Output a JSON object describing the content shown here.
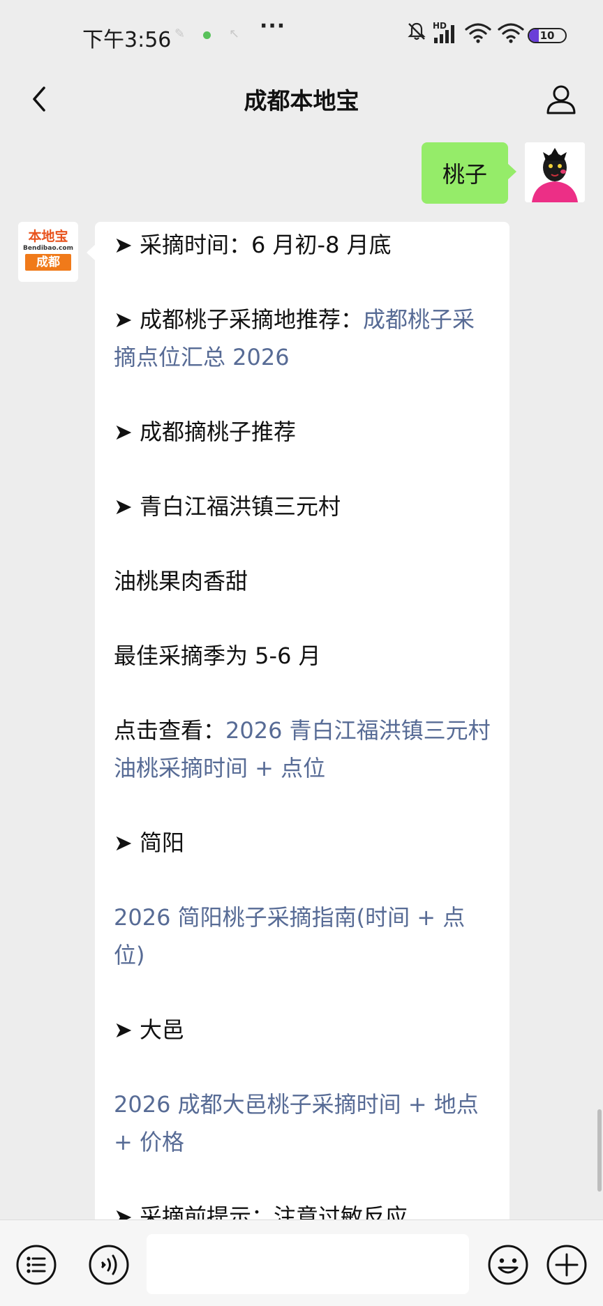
{
  "status_bar": {
    "time": "下午3:56",
    "more": "···",
    "network_label": "HD",
    "battery_level": "10"
  },
  "nav": {
    "title": "成都本地宝"
  },
  "conversation": {
    "user_message": "桃子",
    "bot_logo": {
      "brand": "本地宝",
      "domain": "Bendibao.com",
      "city": "成都"
    },
    "reply": {
      "picking_time": "➤ 采摘时间：6 月初-8 月底",
      "recommend_prefix": "➤ 成都桃子采摘地推荐：",
      "recommend_link": "成都桃子采摘点位汇总 2026",
      "heading_recommend": "➤ 成都摘桃子推荐",
      "heading_sanyuan": "➤ 青白江福洪镇三元村",
      "sanyuan_desc": "油桃果肉香甜",
      "sanyuan_season": "最佳采摘季为 5-6 月",
      "sanyuan_view_prefix": "点击查看：",
      "sanyuan_link": "2026 青白江福洪镇三元村油桃采摘时间 + 点位",
      "heading_jianyang": "➤ 简阳",
      "jianyang_link": "2026 简阳桃子采摘指南(时间 + 点位)",
      "heading_dayi": "➤ 大邑",
      "dayi_link": "2026 成都大邑桃子采摘时间 + 地点 + 价格",
      "cut_off": "➤ 采摘前提示：注意过敏反应"
    }
  },
  "input_bar": {
    "message_value": ""
  },
  "colors": {
    "page_bg": "#ededed",
    "user_bubble": "#95ec69",
    "bot_bubble": "#ffffff",
    "link": "#576b95",
    "brand_orange": "#f07a1a"
  },
  "icons": {
    "back": "chevron-left-icon",
    "profile": "person-icon",
    "menu": "list-icon",
    "voice": "voice-icon",
    "emoji": "smiley-icon",
    "plus": "plus-icon"
  }
}
